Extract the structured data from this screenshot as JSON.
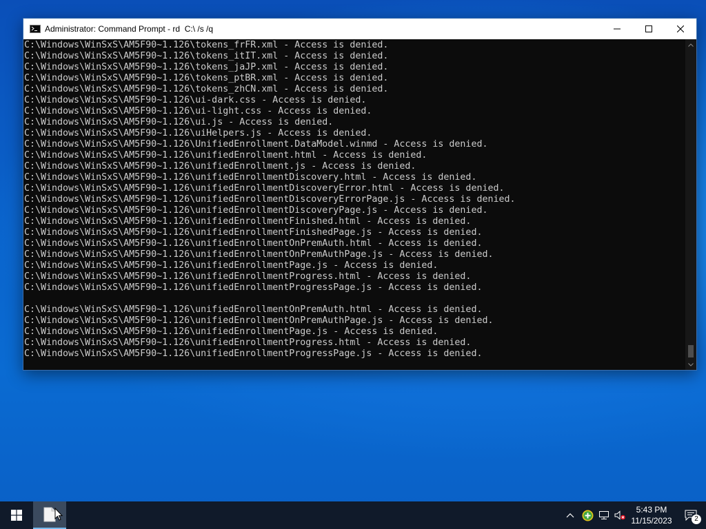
{
  "window": {
    "title": "Administrator: Command Prompt - rd  C:\\ /s /q",
    "minimize_icon": "minimize-icon",
    "maximize_icon": "maximize-icon",
    "close_icon": "close-icon"
  },
  "console": {
    "lines": [
      "C:\\Windows\\WinSxS\\AM5F90~1.126\\tokens_frFR.xml - Access is denied.",
      "C:\\Windows\\WinSxS\\AM5F90~1.126\\tokens_itIT.xml - Access is denied.",
      "C:\\Windows\\WinSxS\\AM5F90~1.126\\tokens_jaJP.xml - Access is denied.",
      "C:\\Windows\\WinSxS\\AM5F90~1.126\\tokens_ptBR.xml - Access is denied.",
      "C:\\Windows\\WinSxS\\AM5F90~1.126\\tokens_zhCN.xml - Access is denied.",
      "C:\\Windows\\WinSxS\\AM5F90~1.126\\ui-dark.css - Access is denied.",
      "C:\\Windows\\WinSxS\\AM5F90~1.126\\ui-light.css - Access is denied.",
      "C:\\Windows\\WinSxS\\AM5F90~1.126\\ui.js - Access is denied.",
      "C:\\Windows\\WinSxS\\AM5F90~1.126\\uiHelpers.js - Access is denied.",
      "C:\\Windows\\WinSxS\\AM5F90~1.126\\UnifiedEnrollment.DataModel.winmd - Access is denied.",
      "C:\\Windows\\WinSxS\\AM5F90~1.126\\unifiedEnrollment.html - Access is denied.",
      "C:\\Windows\\WinSxS\\AM5F90~1.126\\unifiedEnrollment.js - Access is denied.",
      "C:\\Windows\\WinSxS\\AM5F90~1.126\\unifiedEnrollmentDiscovery.html - Access is denied.",
      "C:\\Windows\\WinSxS\\AM5F90~1.126\\unifiedEnrollmentDiscoveryError.html - Access is denied.",
      "C:\\Windows\\WinSxS\\AM5F90~1.126\\unifiedEnrollmentDiscoveryErrorPage.js - Access is denied.",
      "C:\\Windows\\WinSxS\\AM5F90~1.126\\unifiedEnrollmentDiscoveryPage.js - Access is denied.",
      "C:\\Windows\\WinSxS\\AM5F90~1.126\\unifiedEnrollmentFinished.html - Access is denied.",
      "C:\\Windows\\WinSxS\\AM5F90~1.126\\unifiedEnrollmentFinishedPage.js - Access is denied.",
      "C:\\Windows\\WinSxS\\AM5F90~1.126\\unifiedEnrollmentOnPremAuth.html - Access is denied.",
      "C:\\Windows\\WinSxS\\AM5F90~1.126\\unifiedEnrollmentOnPremAuthPage.js - Access is denied.",
      "C:\\Windows\\WinSxS\\AM5F90~1.126\\unifiedEnrollmentPage.js - Access is denied.",
      "C:\\Windows\\WinSxS\\AM5F90~1.126\\unifiedEnrollmentProgress.html - Access is denied.",
      "C:\\Windows\\WinSxS\\AM5F90~1.126\\unifiedEnrollmentProgressPage.js - Access is denied.",
      "",
      "C:\\Windows\\WinSxS\\AM5F90~1.126\\unifiedEnrollmentOnPremAuth.html - Access is denied.",
      "C:\\Windows\\WinSxS\\AM5F90~1.126\\unifiedEnrollmentOnPremAuthPage.js - Access is denied.",
      "C:\\Windows\\WinSxS\\AM5F90~1.126\\unifiedEnrollmentPage.js - Access is denied.",
      "C:\\Windows\\WinSxS\\AM5F90~1.126\\unifiedEnrollmentProgress.html - Access is denied.",
      "C:\\Windows\\WinSxS\\AM5F90~1.126\\unifiedEnrollmentProgressPage.js - Access is denied."
    ]
  },
  "taskbar": {
    "start_icon": "windows-logo-icon",
    "pinned_app_icon": "document-icon",
    "tray_icons": [
      "chevron-up-icon",
      "security-shield-icon",
      "network-icon",
      "speaker-muted-icon"
    ],
    "clock_time": "5:43 PM",
    "clock_date": "11/15/2023",
    "notification_count": "2"
  },
  "colors": {
    "console_bg": "#0c0c0c",
    "console_text": "#cccccc",
    "taskbar_bg": "#101a2a",
    "accent": "#76b9ed"
  }
}
